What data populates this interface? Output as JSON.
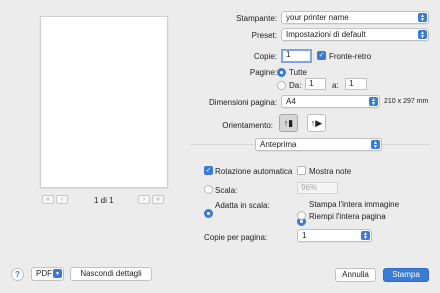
{
  "preview": {
    "page_counter": "1 di 1",
    "first_label": "«",
    "prev_label": "‹",
    "next_label": "›",
    "last_label": "»"
  },
  "settings": {
    "printer_label": "Stampante:",
    "printer_value": "your printer name",
    "preset_label": "Preset:",
    "preset_value": "Impostazioni di default",
    "copies_label": "Copie:",
    "copies_value": "1",
    "duplex_label": "Fronte-retro",
    "pages_label": "Pagine:",
    "pages_all_label": "Tutte",
    "pages_from_label": "Da:",
    "pages_from_value": "1",
    "pages_to_label": "a:",
    "pages_to_value": "1",
    "paper_size_label": "Dimensioni pagina:",
    "paper_size_value": "A4",
    "paper_size_info": "210 x 297 mm",
    "orientation_label": "Orientamento:",
    "section_value": "Anteprima"
  },
  "preview_options": {
    "auto_rotate_label": "Rotazione automatica",
    "show_notes_label": "Mostra note",
    "scale_label": "Scala:",
    "scale_value": "96%",
    "fit_label": "Adatta in scala:",
    "print_entire_label": "Stampa l'intera immagine",
    "fill_page_label": "Riempi l'intera pagina",
    "copies_per_page_label": "Copie per pagina:",
    "copies_per_page_value": "1"
  },
  "footer": {
    "help_label": "?",
    "pdf_label": "PDF",
    "hide_details_label": "Nascondi dettagli",
    "cancel_label": "Annulla",
    "print_label": "Stampa"
  },
  "colors": {
    "accent": "#3a7bd5",
    "background": "#ececec"
  }
}
